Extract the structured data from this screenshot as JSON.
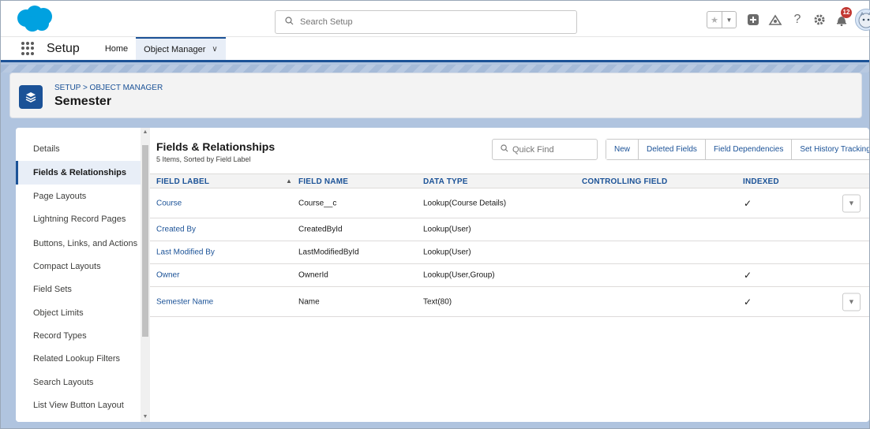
{
  "header": {
    "search_placeholder": "Search Setup",
    "notification_count": "12"
  },
  "nav": {
    "app_name": "Setup",
    "tabs": [
      {
        "label": "Home"
      },
      {
        "label": "Object Manager"
      }
    ]
  },
  "object": {
    "breadcrumb": "SETUP > OBJECT MANAGER",
    "title": "Semester"
  },
  "sidebar": {
    "items": [
      {
        "label": "Details"
      },
      {
        "label": "Fields & Relationships"
      },
      {
        "label": "Page Layouts"
      },
      {
        "label": "Lightning Record Pages"
      },
      {
        "label": "Buttons, Links, and Actions"
      },
      {
        "label": "Compact Layouts"
      },
      {
        "label": "Field Sets"
      },
      {
        "label": "Object Limits"
      },
      {
        "label": "Record Types"
      },
      {
        "label": "Related Lookup Filters"
      },
      {
        "label": "Search Layouts"
      },
      {
        "label": "List View Button Layout"
      }
    ],
    "active_index": 1
  },
  "section": {
    "title": "Fields & Relationships",
    "subtitle": "5 Items, Sorted by Field Label",
    "quick_find_placeholder": "Quick Find",
    "buttons": [
      "New",
      "Deleted Fields",
      "Field Dependencies",
      "Set History Tracking"
    ]
  },
  "table": {
    "columns": [
      "FIELD LABEL",
      "FIELD NAME",
      "DATA TYPE",
      "CONTROLLING FIELD",
      "INDEXED"
    ],
    "rows": [
      {
        "label": "Course",
        "name": "Course__c",
        "type": "Lookup(Course Details)",
        "controlling": "",
        "indexed": true,
        "has_action": true
      },
      {
        "label": "Created By",
        "name": "CreatedById",
        "type": "Lookup(User)",
        "controlling": "",
        "indexed": false,
        "has_action": false
      },
      {
        "label": "Last Modified By",
        "name": "LastModifiedById",
        "type": "Lookup(User)",
        "controlling": "",
        "indexed": false,
        "has_action": false
      },
      {
        "label": "Owner",
        "name": "OwnerId",
        "type": "Lookup(User,Group)",
        "controlling": "",
        "indexed": true,
        "has_action": false
      },
      {
        "label": "Semester Name",
        "name": "Name",
        "type": "Text(80)",
        "controlling": "",
        "indexed": true,
        "has_action": true
      }
    ]
  },
  "colors": {
    "brand": "#1b5297",
    "cloud": "#00a1e0",
    "link": "#1b5297",
    "badge": "#c23934"
  }
}
